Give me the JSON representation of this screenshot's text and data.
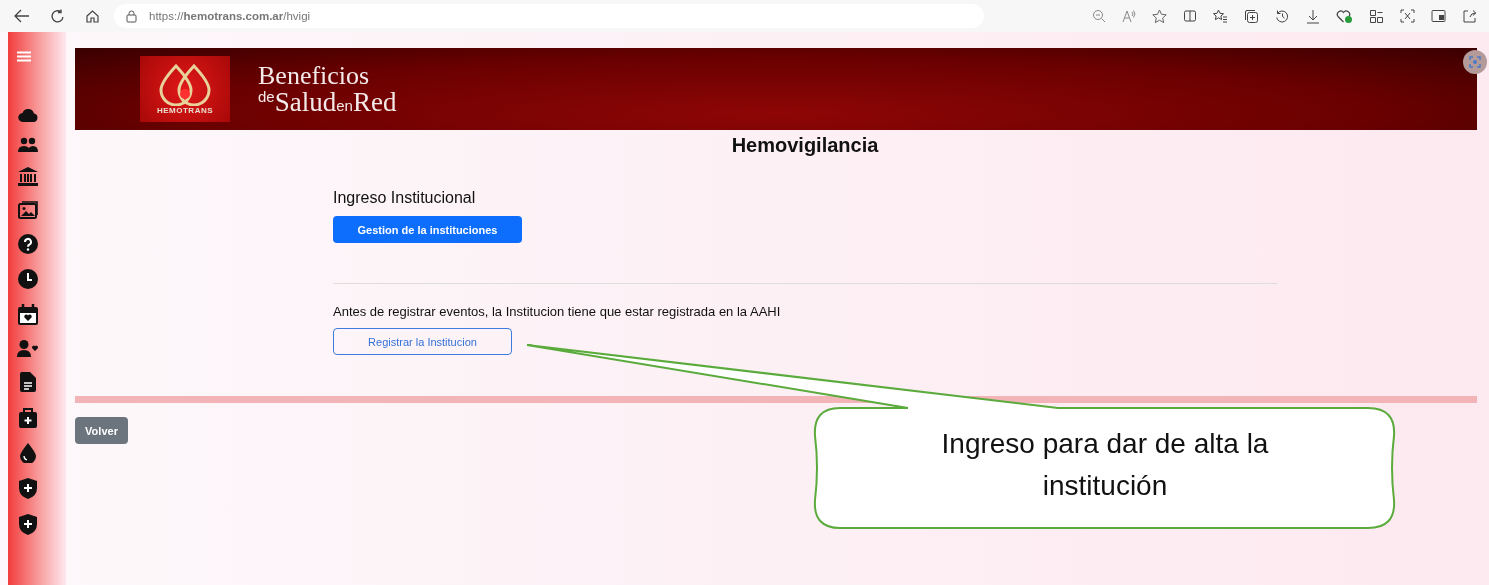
{
  "browser": {
    "url": "https://**hemotrans.com.ar**/hvigi"
  },
  "banner": {
    "logo_text": "HEMOTRANS",
    "title": "Beneficios",
    "subtitle": "$^{de}$Salud$_{en}$Red"
  },
  "page": {
    "title": "Hemovigilancia",
    "section_title": "Ingreso Institucional",
    "primary_button": "Gestion de la instituciones",
    "notice": "Antes de registrar eventos, la Institucion tiene que estar registrada en la AAHI",
    "outline_button": "Registrar la Institucion",
    "back_button": "Volver"
  },
  "callout": {
    "text": "Ingreso para dar de alta la institución"
  }
}
